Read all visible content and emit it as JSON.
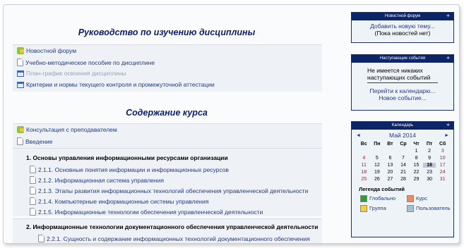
{
  "guide": {
    "title": "Руководство по изучению дисциплины",
    "items": [
      {
        "label": "Новостной форум",
        "icon": "forum-icon"
      },
      {
        "label": "Учебно-методическое пособие по дисциплине",
        "icon": "page-icon"
      },
      {
        "label": "План-график освоения дисциплины",
        "icon": "window-icon",
        "dimmed": true
      },
      {
        "label": "Критерии и нормы текущего контроля и промежуточной аттестации",
        "icon": "window-icon"
      }
    ]
  },
  "content": {
    "title": "Содержание курса",
    "top_items": [
      {
        "label": "Консультация с преподавателем",
        "icon": "forum-icon"
      },
      {
        "label": "Введение",
        "icon": "page-icon"
      }
    ],
    "topic1": {
      "title": "1. Основы управления информационными ресурсами организации",
      "items": [
        "2.1.1. Основные понятия информации и информационных ресурсов",
        "2.1.2. Информационная система управления",
        "2.1.3. Этапы развития информационных технологий обеспечения управленческой деятельности",
        "2.1.4. Компьютерные информационные системы управления",
        "2.1.5. Информационные технологии обеспечения управленческой деятельности"
      ]
    },
    "topic2": {
      "title": "2. Информационные технологии документационного обеспечения управленческой деятельности",
      "items": [
        "2.2.1.   Сущность   и   содержание   информационных   технологий   документационного   обеспечения"
      ]
    }
  },
  "news_block": {
    "title": "Новостной форум",
    "toggle": "≑",
    "add_topic": "Добавить новую тему...",
    "empty": "(Пока новостей нет)"
  },
  "events_block": {
    "title": "Наступающие события",
    "toggle": "≑",
    "none": "Не имеется никаких наступающих событий",
    "goto_calendar": "Перейти к календарю...",
    "new_event": "Новое событие..."
  },
  "calendar": {
    "title": "Календарь",
    "toggle": "≑",
    "prev": "◄",
    "next": "►",
    "month": "Май 2014",
    "weekdays": [
      "Вс",
      "Пн",
      "Вт",
      "Ср",
      "Чт",
      "Пт",
      "Сб"
    ],
    "weeks": [
      [
        "",
        "",
        "",
        "",
        "1",
        "2",
        "3"
      ],
      [
        "4",
        "5",
        "6",
        "7",
        "8",
        "9",
        "10"
      ],
      [
        "11",
        "12",
        "13",
        "14",
        "15",
        "16",
        "17"
      ],
      [
        "18",
        "19",
        "20",
        "21",
        "22",
        "23",
        "24"
      ],
      [
        "25",
        "26",
        "27",
        "28",
        "29",
        "30",
        "31"
      ]
    ],
    "today": "16",
    "legend_title": "Легенда событий",
    "legend": [
      {
        "label": "Глобально",
        "color": "#2e9d3a"
      },
      {
        "label": "Курс",
        "color": "#f08a5d"
      },
      {
        "label": "Группа",
        "color": "#f2d23c"
      },
      {
        "label": "Пользователь",
        "color": "#9fc6d8"
      }
    ]
  }
}
